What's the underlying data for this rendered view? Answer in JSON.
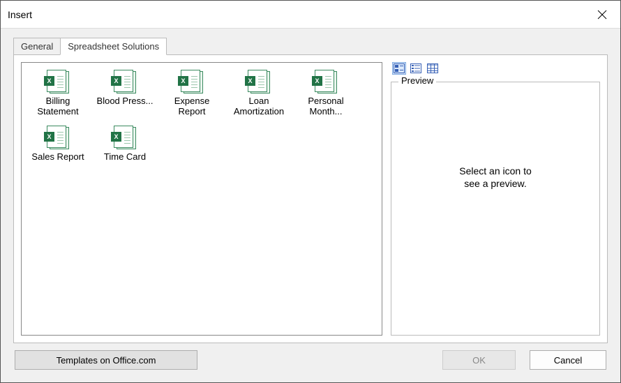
{
  "window": {
    "title": "Insert"
  },
  "tabs": {
    "general": "General",
    "spreadsheet": "Spreadsheet Solutions"
  },
  "templates": [
    {
      "label": "Billing Statement"
    },
    {
      "label": "Blood Press..."
    },
    {
      "label": "Expense Report"
    },
    {
      "label": "Loan Amortization"
    },
    {
      "label": "Personal Month..."
    },
    {
      "label": "Sales Report"
    },
    {
      "label": "Time Card"
    }
  ],
  "preview": {
    "label": "Preview",
    "placeholder_line1": "Select an icon to",
    "placeholder_line2": "see a preview."
  },
  "buttons": {
    "templates_online": "Templates on Office.com",
    "ok": "OK",
    "cancel": "Cancel"
  },
  "icons": {
    "xls_badge": "X"
  }
}
